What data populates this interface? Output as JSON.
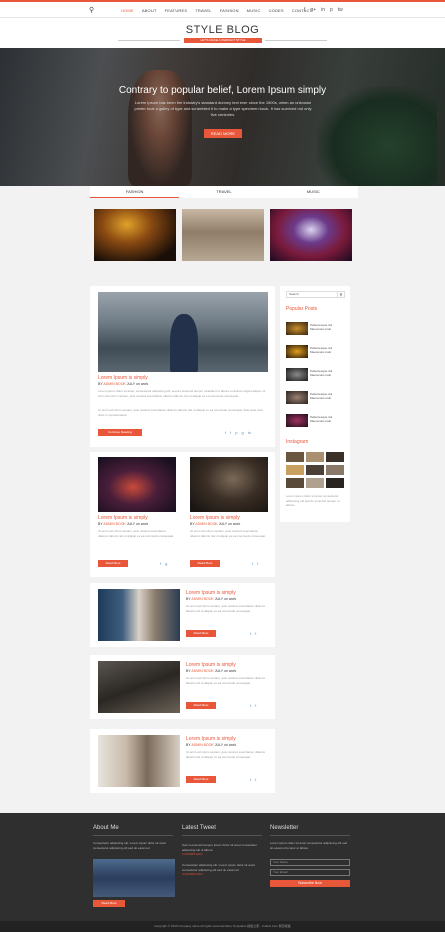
{
  "nav": {
    "menu": [
      "HOME",
      "ABOUT",
      "FEATURES",
      "TRAVEL",
      "FASHION",
      "MUSIC",
      "CODES",
      "CONTACT"
    ],
    "social": [
      "f",
      "g+",
      "in",
      "p",
      "tw"
    ]
  },
  "brand": {
    "title": "STYLE BLOG",
    "tagline": "LET'S MAKE A PERFECT STYLE"
  },
  "hero": {
    "title": "Contrary to popular belief, Lorem Ipsum simply",
    "text": "Lorem Ipsum has been the industry's standard dummy text ever since the 1500s, when an unknown printer took a galley of type and scrambled it to make a type specimen book. It has survived not only five centuries.",
    "button": "READ MORE"
  },
  "categories": [
    "FASHION",
    "TRAVEL",
    "MUSIC"
  ],
  "main_post": {
    "title": "Lorem Ipsum is simply",
    "by": "BY",
    "author": "ADMIN BOOK",
    "date": "JULY on work",
    "text1": "Lorem ipsum dolor sit amet, consectetur adipiscing elit, sed do eiusmod tempor incididunt ut labore et dolore magna aliqua. Ut enim ad minim veniam, quis nostrud exercitation ullamco laboris nisi ut aliquip ex ea commodo consequat.",
    "text2": "Ut enim ad minim veniam, quis nostrud exercitation ullamco laboris nisi ut aliquip ex ea commodo consequat. Duis aute irure dolor in reprehenderit.",
    "button": "Continue Reading"
  },
  "posts": [
    {
      "title": "Lorem Ipsum is simply",
      "by": "BY",
      "author": "ADMIN BOOK",
      "date": "JULY on work",
      "text": "Ut enim ad minim veniam, quis nostrud exercitation ullamco laboris nisi ut aliquip ex ea commodo consequat.",
      "button": "Read More"
    },
    {
      "title": "Lorem Ipsum is simply",
      "by": "BY",
      "author": "ADMIN BOOK",
      "date": "JULY on work",
      "text": "Ut enim ad minim veniam, quis nostrud exercitation ullamco laboris nisi ut aliquip ex ea commodo consequat.",
      "button": "Read More"
    },
    {
      "title": "Lorem Ipsum is simply",
      "by": "BY",
      "author": "ADMIN BOOK",
      "date": "JULY on work",
      "text": "Ut enim ad minim veniam, quis nostrud exercitation ullamco laboris nisi ut aliquip ex ea commodo consequat.",
      "button": "Read More"
    },
    {
      "title": "Lorem Ipsum is simply",
      "by": "BY",
      "author": "ADMIN BOOK",
      "date": "JULY on work",
      "text": "Ut enim ad minim veniam, quis nostrud exercitation ullamco laboris nisi ut aliquip ex ea commodo consequat.",
      "button": "Read More"
    },
    {
      "title": "Lorem Ipsum is simply",
      "by": "BY",
      "author": "ADMIN BOOK",
      "date": "JULY on work",
      "text": "Ut enim ad minim veniam, quis nostrud exercitation ullamco laboris nisi ut aliquip ex ea commodo consequat.",
      "button": "Read More"
    }
  ],
  "sidebar": {
    "search_placeholder": "Search",
    "popular_title": "Popular Posts",
    "popular": [
      "Pellentesque dui Maecenas malo",
      "Pellentesque dui Maecenas malo",
      "Pellentesque dui Maecenas malo",
      "Pellentesque dui Maecenas malo",
      "Pellentesque dui Maecenas malo"
    ],
    "instagram_title": "Instagram",
    "instagram_text": "Lorem ipsum dolor sit amet consectetur adipiscing elit sed do eiusmod tempor ut labore."
  },
  "footer": {
    "about_title": "About Me",
    "about_text": "Consectetur adipiscing elit. Lorem ipsum dolor sit amet consectetur adipiscing elit sed do eiusmod.",
    "about_button": "Read More",
    "tweet_title": "Latest Tweet",
    "tweets": [
      {
        "text": "Sed ut euismod tempor ipsum dolor sit amet consectetur adipiscing elit ut labore.",
        "date": "2 HOURS AGO"
      },
      {
        "text": "Consectetur adipiscing elit. Lorem ipsum dolor sit amet consectetur adipiscing elit sed do eiusmod.",
        "date": "3 HOURS AGO"
      }
    ],
    "newsletter_title": "Newsletter",
    "newsletter_text": "Lorem ipsum dolor sit amet consectetur adipiscing elit sed do eiusmod tempor ut labore.",
    "name_placeholder": "Your Name",
    "email_placeholder": "Your Email",
    "subscribe": "Subscribe Now"
  },
  "copyright": "Copyright © 2016 Company name All rights reserved.More Templates 模板之家 - Collect from 网页模板"
}
